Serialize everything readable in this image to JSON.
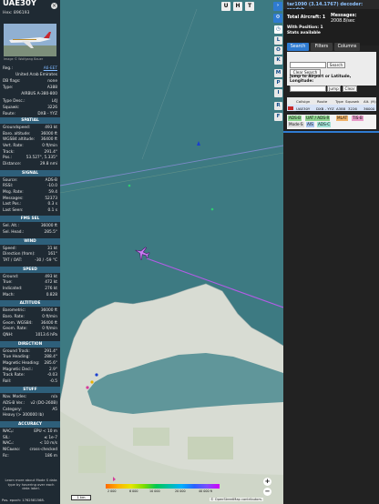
{
  "aircraft": {
    "callsign": "UAE30Y",
    "hex_label": "Hex: 896193",
    "photo_credit": "Image © Wolfgang Bauer",
    "reg": "A6-EET",
    "country": "United Arab Emirates",
    "db_flags": "none",
    "type": "A388",
    "type_name": "AIRBUS A-380-800",
    "type_desc": "L4J",
    "squawk": "3226",
    "route": "DXB - YYZ"
  },
  "labels": {
    "reg": "Reg.:",
    "db_flags": "DB flags:",
    "type": "Type:",
    "type_desc": "Type Desc.:",
    "squawk": "Squawk:",
    "route": "Route:"
  },
  "sections": [
    {
      "title": "SPATIAL",
      "rows": [
        {
          "k": "Groundspeed:",
          "v": "493 kt"
        },
        {
          "k": "Baro. altitude:",
          "v": "36000 ft"
        },
        {
          "k": "WGS84 altitude:",
          "v": "36400 ft"
        },
        {
          "k": "Vert. Rate:",
          "v": "0 ft/min"
        },
        {
          "k": "Track:",
          "v": "291.4°"
        },
        {
          "k": "Pos.:",
          "v": "53.527°, 5.335°"
        },
        {
          "k": "Distance:",
          "v": "29.8 nmi"
        }
      ]
    },
    {
      "title": "SIGNAL",
      "rows": [
        {
          "k": "Source:",
          "v": "ADS-B"
        },
        {
          "k": "RSSI:",
          "v": "-10.0"
        },
        {
          "k": "Msg. Rate:",
          "v": "59.4"
        },
        {
          "k": "Messages:",
          "v": "52373"
        },
        {
          "k": "Last Pos.:",
          "v": "0.3 s"
        },
        {
          "k": "Last Seen:",
          "v": "0.1 s"
        }
      ]
    },
    {
      "title": "FMS SEL",
      "rows": [
        {
          "k": "Sel. Alt.:",
          "v": "36000 ft"
        },
        {
          "k": "Sel. Head.:",
          "v": "285.5°"
        }
      ]
    },
    {
      "title": "WIND",
      "rows": [
        {
          "k": "Speed:",
          "v": "31 kt"
        },
        {
          "k": "Direction (from):",
          "v": "161°"
        },
        {
          "k": "TAT / OAT:",
          "v": "-30 / -59 °C"
        }
      ]
    },
    {
      "title": "SPEED",
      "rows": [
        {
          "k": "Ground:",
          "v": "493 kt"
        },
        {
          "k": "True:",
          "v": "472 kt"
        },
        {
          "k": "Indicated:",
          "v": "276 kt"
        },
        {
          "k": "Mach:",
          "v": "0.828"
        }
      ]
    },
    {
      "title": "ALTITUDE",
      "rows": [
        {
          "k": "Barometric:",
          "v": "36000 ft"
        },
        {
          "k": "Baro. Rate:",
          "v": "0 ft/min"
        },
        {
          "k": "Geom. WGS84:",
          "v": "36400 ft"
        },
        {
          "k": "Geom. Rate:",
          "v": "0 ft/min"
        },
        {
          "k": "QNH:",
          "v": "1013.6 hPa"
        }
      ]
    },
    {
      "title": "DIRECTION",
      "rows": [
        {
          "k": "Ground Track:",
          "v": "291.4°"
        },
        {
          "k": "True Heading:",
          "v": "288.4°"
        },
        {
          "k": "Magnetic Heading:",
          "v": "285.6°"
        },
        {
          "k": "Magnetic Decl.:",
          "v": "2.9°"
        },
        {
          "k": "Track Rate:",
          "v": "-0.03"
        },
        {
          "k": "Roll:",
          "v": "-0.5"
        }
      ]
    },
    {
      "title": "STUFF",
      "rows": [
        {
          "k": "Nav. Modes:",
          "v": "n/a"
        },
        {
          "k": "ADS-B Ver.:",
          "v": "v2 (DO-260B)"
        },
        {
          "k": "Category:",
          "v": "A5"
        },
        {
          "k": "Heavy (> 300000 lb)",
          "v": ""
        }
      ]
    },
    {
      "title": "ACCURACY",
      "rows": [
        {
          "k": "NACₚ:",
          "v": "EPU < 10 m"
        },
        {
          "k": "SIL:",
          "v": "≤ 1e-7"
        },
        {
          "k": "NACᵥ:",
          "v": "< 10 m/s"
        },
        {
          "k": "NICʙᴀʀᴏ:",
          "v": "cross-checked"
        },
        {
          "k": "Rᴄ:",
          "v": "186 m"
        }
      ]
    }
  ],
  "side_note": "Learn more about Mode S data type by hovering over each data label.",
  "side_pos": "Pos. epoch:  1762581568.",
  "map": {
    "top_buttons": [
      "U",
      "H",
      "T"
    ],
    "right_buttons": [
      "L",
      "O",
      "K",
      "M",
      "P",
      "I",
      "R",
      "F"
    ],
    "scale": "1 km",
    "attribution": "© OpenStreetMap contributors.",
    "colorbar_labels": [
      "2 000",
      "6 000",
      "10 000",
      "20 000",
      "40 000 ft"
    ],
    "zoom_in": "+",
    "zoom_out": "−"
  },
  "right": {
    "link": "tar1090 (3.14.1767) decoder: readsb",
    "link_short": "readsb",
    "total_aircraft": "Total Aircraft: 1",
    "messages": "Messages:",
    "msg_rate": "2008.8/sec",
    "with_position": "With Position: 1",
    "stats": "Stats available",
    "tabs": [
      "Search",
      "Filters",
      "Columns"
    ],
    "search_btn": "Search",
    "clear_search": "Clear Search",
    "jump_label": "Jump to Airport or Latitude, Longitude:",
    "jump_btn": "Jump",
    "clear_btn": "Clear",
    "table_headers": [
      "Callsign",
      "Route",
      "Type",
      "Squawk",
      "Alt. (ft)"
    ],
    "table_row": [
      "UAE30Y",
      "DXB - YYZ",
      "A388",
      "3226",
      "36000"
    ],
    "legend": [
      "ADS-B",
      "UAT / ADS-R",
      "MLAT",
      "TIS-B",
      "Mode-S",
      "AIS",
      "ADS-C"
    ],
    "legend_colors": [
      "#1db41d",
      "#1db41d",
      "#e07b00",
      "#d43b9a",
      "#888",
      "#4b8bd6",
      "#40c0b0"
    ]
  }
}
